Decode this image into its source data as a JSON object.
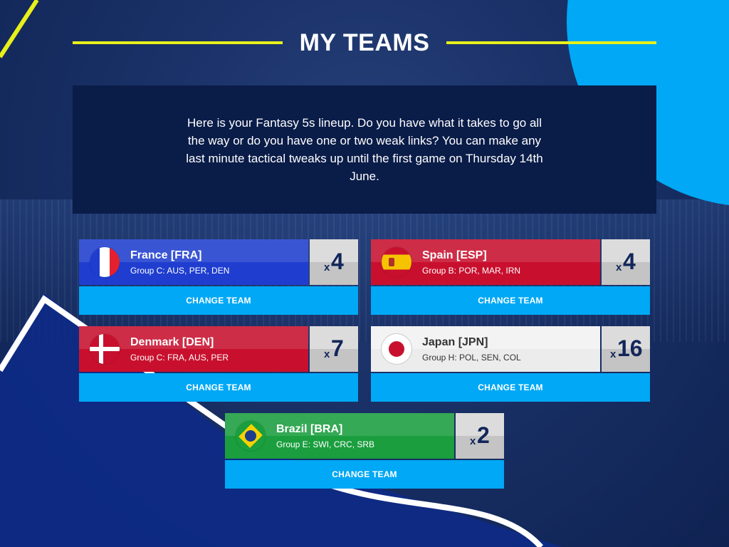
{
  "title": "MY TEAMS",
  "intro": "Here is your Fantasy 5s lineup. Do you have what it takes to go all the way or do you have one or two weak links? You can make any last minute tactical tweaks up until the first game on Thursday 14th June.",
  "colors": {
    "accent_yellow": "#e8f01a",
    "button_blue": "#00a8f5",
    "panel_navy": "#0a1c48"
  },
  "teams": [
    {
      "name": "France [FRA]",
      "group": "Group C: AUS, PER, DEN",
      "multiplier_prefix": "x",
      "multiplier": "4",
      "button": "CHANGE TEAM",
      "color": "#1f3ecf",
      "flag_icon": "france-flag-icon"
    },
    {
      "name": "Spain [ESP]",
      "group": "Group B: POR, MAR, IRN",
      "multiplier_prefix": "x",
      "multiplier": "4",
      "button": "CHANGE TEAM",
      "color": "#c8102e",
      "flag_icon": "spain-flag-icon"
    },
    {
      "name": "Denmark [DEN]",
      "group": "Group C: FRA, AUS, PER",
      "multiplier_prefix": "x",
      "multiplier": "7",
      "button": "CHANGE TEAM",
      "color": "#c8102e",
      "flag_icon": "denmark-flag-icon"
    },
    {
      "name": "Japan [JPN]",
      "group": "Group H: POL, SEN, COL",
      "multiplier_prefix": "x",
      "multiplier": "16",
      "button": "CHANGE TEAM",
      "color": "#ececec",
      "flag_icon": "japan-flag-icon"
    },
    {
      "name": "Brazil [BRA]",
      "group": "Group E: SWI, CRC, SRB",
      "multiplier_prefix": "x",
      "multiplier": "2",
      "button": "CHANGE TEAM",
      "color": "#1a9e3e",
      "flag_icon": "brazil-flag-icon"
    }
  ]
}
